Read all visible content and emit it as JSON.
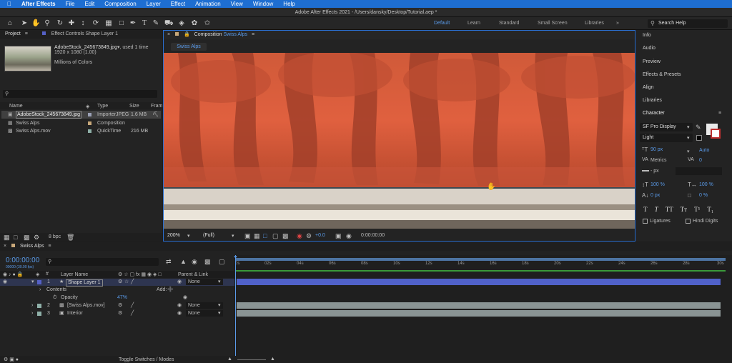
{
  "menubar": {
    "app": "After Effects",
    "items": [
      "File",
      "Edit",
      "Composition",
      "Layer",
      "Effect",
      "Animation",
      "View",
      "Window",
      "Help"
    ]
  },
  "window": {
    "title": "Adobe After Effects 2021 - /Users/dansky/Desktop/Tutorial.aep *"
  },
  "workspaces": [
    "Default",
    "Learn",
    "Standard",
    "Small Screen",
    "Libraries"
  ],
  "search_help": "Search Help",
  "project": {
    "tab": "Project",
    "effect_controls": "Effect Controls Shape Layer 1",
    "asset_name": "AdobeStock_245673849.jpg",
    "used": ", used 1 time",
    "dims": "1920 x 1080 (1.00)",
    "colors": "Millions of Colors",
    "columns": [
      "Name",
      "Type",
      "Size",
      "Fram"
    ],
    "items": [
      {
        "name": "AdobeStock_245673849.jpg",
        "type": "ImporterJPEG",
        "size": "1.6 MB",
        "color": "#9aa0b5"
      },
      {
        "name": "Swiss Alps",
        "type": "Composition",
        "size": "",
        "color": "#c8a87a"
      },
      {
        "name": "Swiss Alps.mov",
        "type": "QuickTime",
        "size": "216 MB",
        "color": "#8fb0a8"
      }
    ],
    "bpc": "8 bpc"
  },
  "composition": {
    "tab_label": "Composition",
    "tab_name": "Swiss Alps",
    "breadcrumb": "Swiss Alps",
    "zoom": "200%",
    "resolution": "(Full)",
    "exposure": "+0.0",
    "timecode": "0:00:00:00"
  },
  "right": {
    "links": [
      "Info",
      "Audio",
      "Preview",
      "Effects & Presets",
      "Align",
      "Libraries"
    ],
    "character": "Character",
    "font": "SF Pro Display",
    "style": "Light",
    "size": "90 px",
    "leading": "Auto",
    "kerning": "Metrics",
    "tracking": "0",
    "stroke": "- px",
    "vscale": "100 %",
    "hscale": "100 %",
    "baseline": "0 px",
    "tsume": "0 %",
    "ligatures": "Ligatures",
    "hindi": "Hindi Digits",
    "accent_blue": "#5a9bea"
  },
  "timeline": {
    "tab": "Swiss Alps",
    "timecode": "0:00:00:00",
    "fps": "00000 (30.00 fps)",
    "col_layer": "Layer Name",
    "col_parent": "Parent & Link",
    "ticks": [
      "0s",
      "02s",
      "04s",
      "06s",
      "08s",
      "10s",
      "12s",
      "14s",
      "16s",
      "18s",
      "20s",
      "22s",
      "24s",
      "26s",
      "28s",
      "30s"
    ],
    "layers": [
      {
        "num": "1",
        "name": "Shape Layer 1",
        "parent": "None",
        "bar_color": "#5061c9"
      },
      {
        "num": "2",
        "name": "[Swiss Alps.mov]",
        "parent": "None",
        "bar_color": "#8a9494"
      },
      {
        "num": "3",
        "name": "Interior",
        "parent": "None",
        "bar_color": "#8a9494"
      }
    ],
    "contents": "Contents",
    "add": "Add:",
    "opacity_label": "Opacity",
    "opacity_value": "47%",
    "toggle": "Toggle Switches / Modes"
  }
}
